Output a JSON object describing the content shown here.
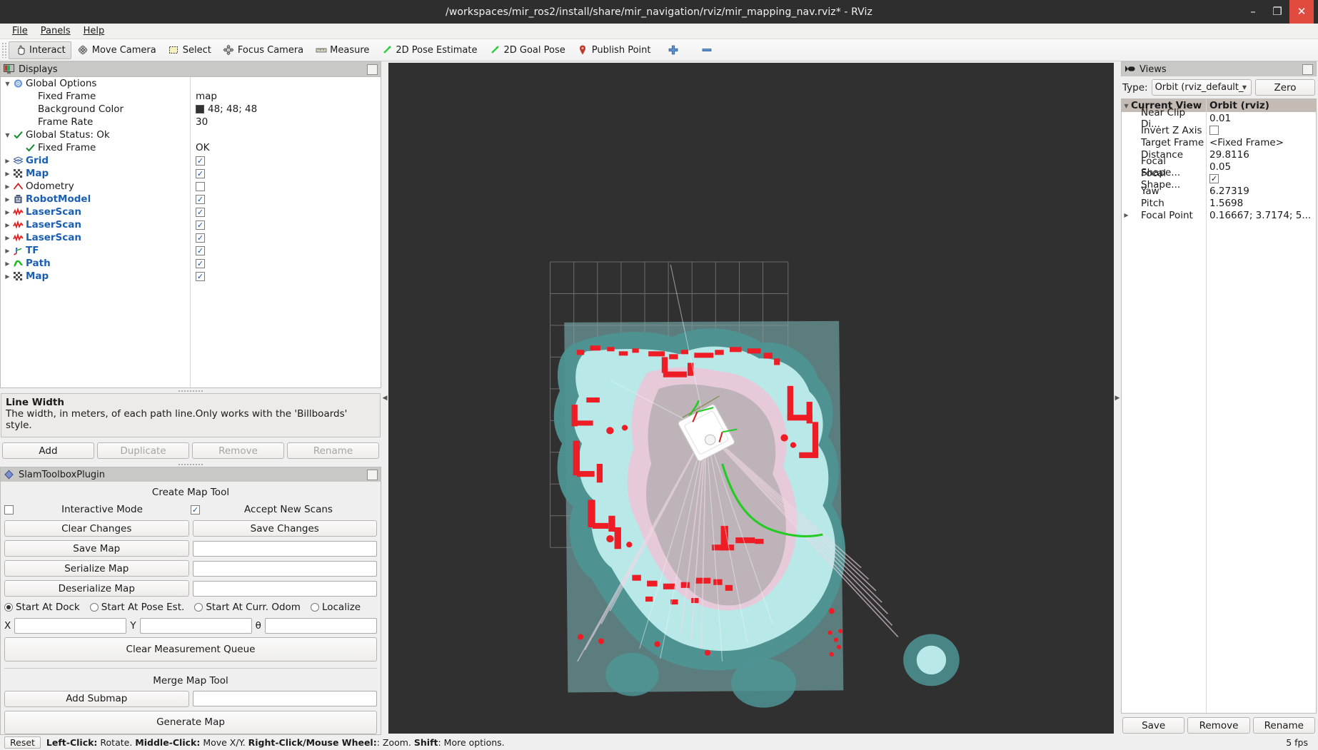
{
  "window": {
    "title": "/workspaces/mir_ros2/install/share/mir_navigation/rviz/mir_mapping_nav.rviz* - RViz",
    "minimize": "–",
    "maximize": "❐",
    "close": "✕"
  },
  "menubar": [
    {
      "label": "File",
      "mnemonic": "F"
    },
    {
      "label": "Panels",
      "mnemonic": "P"
    },
    {
      "label": "Help",
      "mnemonic": "H"
    }
  ],
  "toolbar": [
    {
      "label": "Interact",
      "icon": "hand-cursor-icon",
      "checked": true
    },
    {
      "label": "Move Camera",
      "icon": "move-camera-icon",
      "checked": false
    },
    {
      "label": "Select",
      "icon": "select-rect-icon",
      "checked": false
    },
    {
      "label": "Focus Camera",
      "icon": "focus-camera-icon",
      "checked": false
    },
    {
      "label": "Measure",
      "icon": "ruler-icon",
      "checked": false
    },
    {
      "label": "2D Pose Estimate",
      "icon": "pose-arrow-icon",
      "checked": false
    },
    {
      "label": "2D Goal Pose",
      "icon": "goal-arrow-icon",
      "checked": false
    },
    {
      "label": "Publish Point",
      "icon": "map-pin-icon",
      "checked": false
    },
    {
      "label": "",
      "icon": "plus-icon",
      "checked": false
    },
    {
      "label": "",
      "icon": "minus-icon",
      "checked": false
    }
  ],
  "displays": {
    "panel_title": "Displays",
    "rows": [
      {
        "indent": 0,
        "arrow": "down",
        "icon": "gear-icon",
        "label": "Global Options",
        "bold": false,
        "value_type": "none",
        "value": ""
      },
      {
        "indent": 1,
        "arrow": "none",
        "icon": "none",
        "label": "Fixed Frame",
        "bold": false,
        "value_type": "text",
        "value": "map"
      },
      {
        "indent": 1,
        "arrow": "none",
        "icon": "none",
        "label": "Background Color",
        "bold": false,
        "value_type": "color",
        "value": "48; 48; 48"
      },
      {
        "indent": 1,
        "arrow": "none",
        "icon": "none",
        "label": "Frame Rate",
        "bold": false,
        "value_type": "text",
        "value": "30"
      },
      {
        "indent": 0,
        "arrow": "down",
        "icon": "check-icon",
        "label": "Global Status: Ok",
        "bold": false,
        "value_type": "none",
        "value": ""
      },
      {
        "indent": 1,
        "arrow": "none",
        "icon": "check-icon",
        "label": "Fixed Frame",
        "bold": false,
        "value_type": "text",
        "value": "OK"
      },
      {
        "indent": 0,
        "arrow": "right",
        "icon": "grid-icon",
        "label": "Grid",
        "bold": true,
        "value_type": "check",
        "value": true
      },
      {
        "indent": 0,
        "arrow": "right",
        "icon": "map-icon",
        "label": "Map",
        "bold": true,
        "value_type": "check",
        "value": true
      },
      {
        "indent": 0,
        "arrow": "right",
        "icon": "odometry-icon",
        "label": "Odometry",
        "bold": false,
        "value_type": "check",
        "value": false
      },
      {
        "indent": 0,
        "arrow": "right",
        "icon": "robot-model-icon",
        "label": "RobotModel",
        "bold": true,
        "value_type": "check",
        "value": true
      },
      {
        "indent": 0,
        "arrow": "right",
        "icon": "laserscan-icon",
        "label": "LaserScan",
        "bold": true,
        "value_type": "check",
        "value": true
      },
      {
        "indent": 0,
        "arrow": "right",
        "icon": "laserscan-icon",
        "label": "LaserScan",
        "bold": true,
        "value_type": "check",
        "value": true
      },
      {
        "indent": 0,
        "arrow": "right",
        "icon": "laserscan-icon",
        "label": "LaserScan",
        "bold": true,
        "value_type": "check",
        "value": true
      },
      {
        "indent": 0,
        "arrow": "right",
        "icon": "tf-icon",
        "label": "TF",
        "bold": true,
        "value_type": "check",
        "value": true
      },
      {
        "indent": 0,
        "arrow": "right",
        "icon": "path-icon",
        "label": "Path",
        "bold": true,
        "value_type": "check",
        "value": true
      },
      {
        "indent": 0,
        "arrow": "right",
        "icon": "map-icon",
        "label": "Map",
        "bold": true,
        "value_type": "check",
        "value": true
      }
    ],
    "description": {
      "title": "Line Width",
      "body": "The width, in meters, of each path line.Only works with the 'Billboards' style."
    },
    "buttons": [
      {
        "label": "Add",
        "disabled": false
      },
      {
        "label": "Duplicate",
        "disabled": true
      },
      {
        "label": "Remove",
        "disabled": true
      },
      {
        "label": "Rename",
        "disabled": true
      }
    ]
  },
  "slam": {
    "panel_title": "SlamToolboxPlugin",
    "create_map_tool_label": "Create Map Tool",
    "interactive_mode_label": "Interactive Mode",
    "interactive_mode_checked": false,
    "accept_new_scans_label": "Accept New Scans",
    "accept_new_scans_checked": true,
    "clear_changes_label": "Clear Changes",
    "save_changes_label": "Save Changes",
    "save_map_label": "Save Map",
    "save_map_value": "",
    "serialize_map_label": "Serialize Map",
    "serialize_map_value": "",
    "deserialize_map_label": "Deserialize Map",
    "deserialize_map_value": "",
    "start_options": [
      {
        "label": "Start At Dock",
        "selected": true
      },
      {
        "label": "Start At Pose Est.",
        "selected": false
      },
      {
        "label": "Start At Curr. Odom",
        "selected": false
      },
      {
        "label": "Localize",
        "selected": false
      }
    ],
    "x_label": "X",
    "x_value": "",
    "y_label": "Y",
    "y_value": "",
    "theta_label": "θ",
    "theta_value": "",
    "clear_measurement_queue_label": "Clear Measurement Queue",
    "merge_map_tool_label": "Merge Map Tool",
    "add_submap_label": "Add Submap",
    "add_submap_value": "",
    "generate_map_label": "Generate Map"
  },
  "views": {
    "panel_title": "Views",
    "type_label": "Type:",
    "type_value": "Orbit (rviz_default_",
    "zero_label": "Zero",
    "header": {
      "name": "Current View",
      "value": "Orbit (rviz)"
    },
    "rows": [
      {
        "label": "Near Clip Di...",
        "value": "0.01",
        "type": "text",
        "arrow": "none"
      },
      {
        "label": "Invert Z Axis",
        "value": false,
        "type": "check",
        "arrow": "none"
      },
      {
        "label": "Target Frame",
        "value": "<Fixed Frame>",
        "type": "text",
        "arrow": "none"
      },
      {
        "label": "Distance",
        "value": "29.8116",
        "type": "text",
        "arrow": "none"
      },
      {
        "label": "Focal Shape...",
        "value": "0.05",
        "type": "text",
        "arrow": "none"
      },
      {
        "label": "Focal Shape...",
        "value": true,
        "type": "check",
        "arrow": "none"
      },
      {
        "label": "Yaw",
        "value": "6.27319",
        "type": "text",
        "arrow": "none"
      },
      {
        "label": "Pitch",
        "value": "1.5698",
        "type": "text",
        "arrow": "none"
      },
      {
        "label": "Focal Point",
        "value": "0.16667; 3.7174; 5...",
        "type": "text",
        "arrow": "right"
      }
    ],
    "buttons": [
      {
        "label": "Save"
      },
      {
        "label": "Remove"
      },
      {
        "label": "Rename"
      }
    ]
  },
  "statusbar": {
    "reset_label": "Reset",
    "hint_parts": [
      {
        "text": "Left-Click:",
        "bold": true
      },
      {
        "text": " Rotate. ",
        "bold": false
      },
      {
        "text": "Middle-Click:",
        "bold": true
      },
      {
        "text": " Move X/Y. ",
        "bold": false
      },
      {
        "text": "Right-Click/Mouse Wheel:",
        "bold": true
      },
      {
        "text": ": Zoom. ",
        "bold": false
      },
      {
        "text": "Shift",
        "bold": true
      },
      {
        "text": ": More options.",
        "bold": false
      }
    ],
    "fps": "5 fps"
  },
  "colors": {
    "viewport_bg": "#303030",
    "accent_blue": "#1b5fb3",
    "laser_red": "#ee1c25",
    "path_green": "#22cc22",
    "free_space": "#b9e8e8",
    "inflation_teal": "#5a9e9e",
    "cost_pink": "#e8c4d6",
    "map_overlay": "#6d9b9b"
  }
}
